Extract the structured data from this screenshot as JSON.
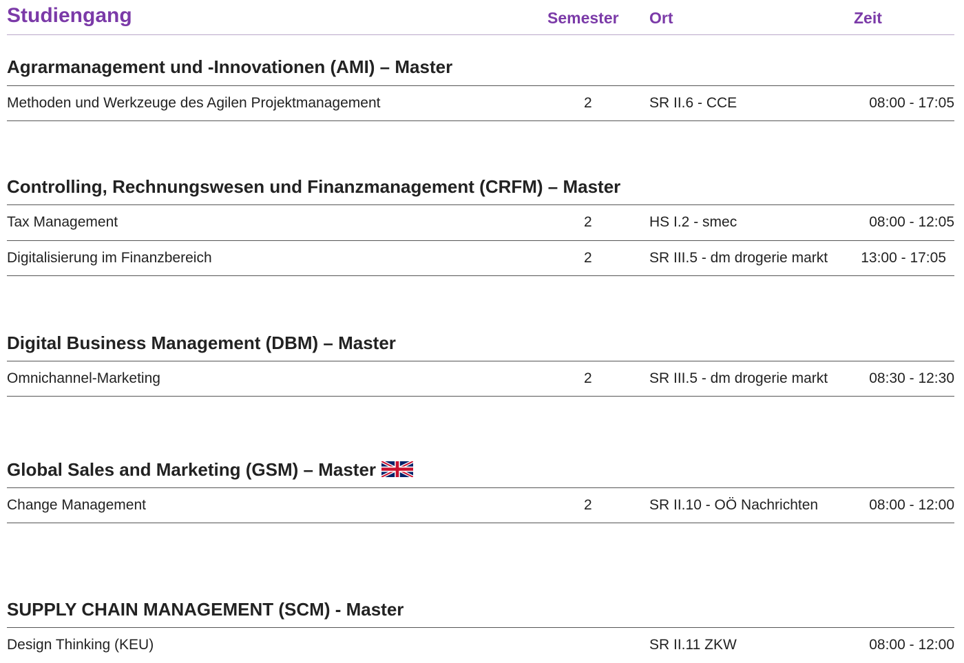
{
  "header": {
    "studiengang": "Studiengang",
    "semester": "Semester",
    "ort": "Ort",
    "zeit": "Zeit",
    "accent_color": "#7b3aa8"
  },
  "groups": [
    {
      "title": " Agrarmanagement und -Innovationen (AMI) – Master",
      "rows": [
        {
          "name": "Methoden und Werkzeuge des Agilen Projektmanagement",
          "semester": "2",
          "ort": "SR II.6 - CCE",
          "zeit": "08:00 - 17:05"
        }
      ]
    },
    {
      "title": "Controlling, Rechnungswesen und Finanzmanagement (CRFM) – Master",
      "rows": [
        {
          "name": "Tax Management",
          "semester": "2",
          "ort": "HS I.2 - smec",
          "zeit": "08:00 - 12:05"
        },
        {
          "name": "Digitalisierung im Finanzbereich",
          "semester": "2",
          "ort": "SR III.5 - dm drogerie markt",
          "zeit": "13:00 - 17:05"
        }
      ]
    },
    {
      "title": "Digital Business Management (DBM) – Master",
      "rows": [
        {
          "name": "Omnichannel-Marketing",
          "semester": "2",
          "ort": "SR III.5 - dm drogerie markt",
          "zeit": "08:30 - 12:30"
        }
      ]
    },
    {
      "title": "Global Sales and Marketing (GSM) – Master",
      "flag_icon": "uk-flag-icon",
      "rows": [
        {
          "name": "Change Management",
          "semester": "2",
          "ort": "SR II.10 - OÖ Nachrichten",
          "zeit": "08:00 - 12:00"
        }
      ]
    },
    {
      "title": "SUPPLY CHAIN MANAGEMENT (SCM) - Master",
      "rows": [
        {
          "name": "Design Thinking (KEU)",
          "semester": "",
          "ort": "SR II.11 ZKW",
          "zeit": "08:00 - 12:00"
        }
      ]
    }
  ]
}
